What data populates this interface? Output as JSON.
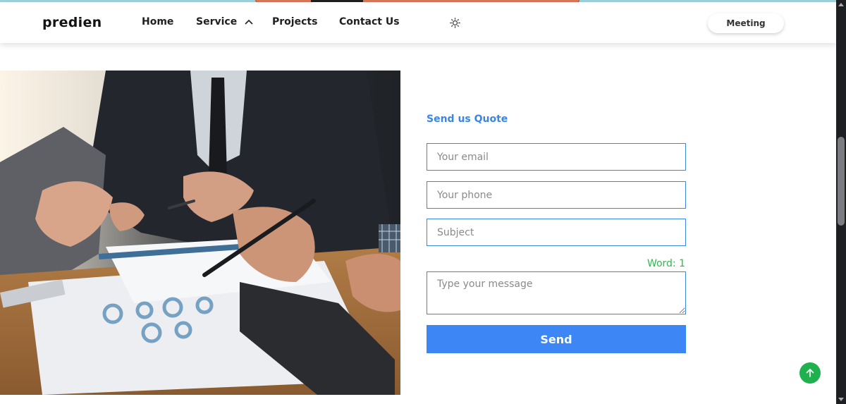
{
  "header": {
    "logo": "predien",
    "nav": {
      "home": "Home",
      "service": "Service",
      "projects": "Projects",
      "contact": "Contact Us"
    },
    "meeting_label": "Meeting"
  },
  "form": {
    "title": "Send us Quote",
    "email_placeholder": "Your email",
    "phone_placeholder": "Your phone",
    "subject_placeholder": "Subject",
    "word_count": "Word: 1",
    "message_placeholder": "Type your message",
    "send_label": "Send"
  },
  "colors": {
    "accent": "#3a86e8",
    "button": "#3d86f5",
    "success": "#2db84b",
    "back_to_top": "#1fb14d"
  },
  "icons": {
    "theme": "sun-icon",
    "service_toggle": "chevron-up-icon",
    "back_to_top": "arrow-up-icon"
  }
}
